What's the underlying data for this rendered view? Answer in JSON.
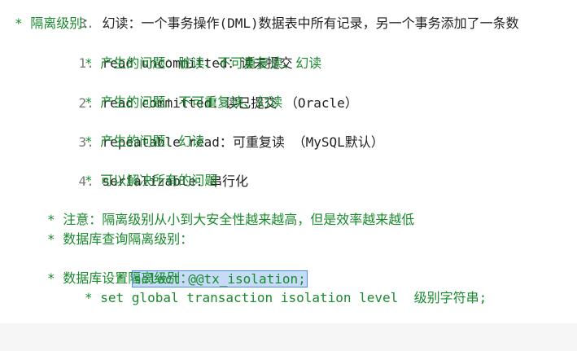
{
  "lines": [
    {
      "num": "3.",
      "text": "幻读：一个事务操作(DML)数据表中所有记录，另一个事务添加了一条数"
    },
    {
      "text": "* 隔离级别："
    },
    {
      "num": "1.",
      "text": "read uncommitted：读未提交"
    },
    {
      "text": "* 产生的问题：脏读、不可重复读、幻读"
    },
    {
      "num": "2.",
      "text": "read committed：读已提交 （Oracle）"
    },
    {
      "text": "* 产生的问题：不可重复读、幻读"
    },
    {
      "num": "3.",
      "text": "repeatable read：可重复读 （MySQL默认）"
    },
    {
      "text": "* 产生的问题：幻读"
    },
    {
      "num": "4.",
      "text": "serializable：串行化"
    },
    {
      "text": "* 可以解决所有的问题"
    },
    {
      "text": "* 注意：隔离级别从小到大安全性越来越高，但是效率越来越低"
    },
    {
      "text": "* 数据库查询隔离级别："
    },
    {
      "bullet": "*",
      "selected": "select @@tx_isolation;"
    },
    {
      "text": "* 数据库设置隔离级别："
    },
    {
      "text": "* set global transaction isolation level  级别字符串;"
    }
  ]
}
